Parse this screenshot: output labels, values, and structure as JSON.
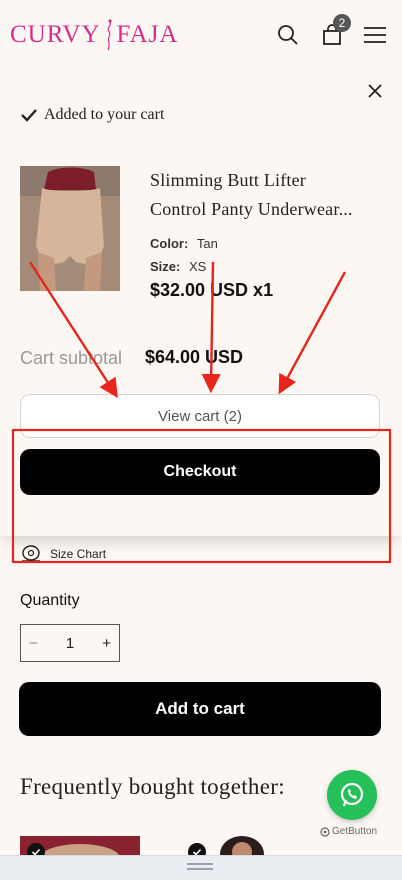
{
  "header": {
    "logo_left": "CURVY",
    "logo_right": "FAJA",
    "cart_count": "2"
  },
  "popup": {
    "added_text": "Added to your cart",
    "product": {
      "title_line1": "Slimming Butt Lifter",
      "title_line2": "Control Panty Underwear...",
      "color_label": "Color:",
      "color_value": "Tan",
      "size_label": "Size:",
      "size_value": "XS",
      "price": "$32.00 USD x1"
    },
    "subtotal_label": "Cart subtotal",
    "subtotal_value": "$64.00 USD",
    "view_cart_label": "View cart (2)",
    "checkout_label": "Checkout"
  },
  "page": {
    "size_chart_label": "Size Chart",
    "quantity_label": "Quantity",
    "quantity_value": "1",
    "qty_minus": "−",
    "qty_plus": "+",
    "add_to_cart_label": "Add to cart",
    "fbt_heading": "Frequently bought together:"
  },
  "widgets": {
    "getbutton_label": "GetButton"
  },
  "colors": {
    "brand_pink": "#d62d8a",
    "annotation_red": "#e8251c",
    "whatsapp_green": "#25c05a"
  }
}
